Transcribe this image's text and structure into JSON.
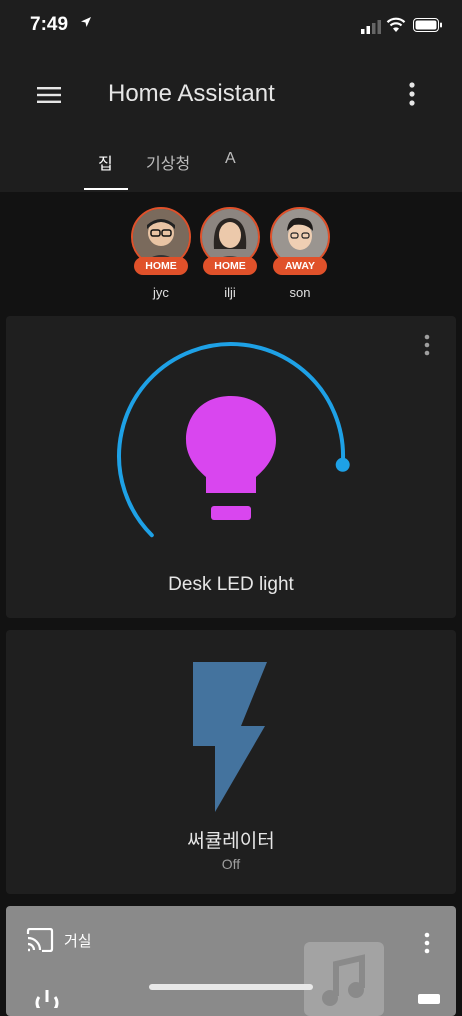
{
  "status_bar": {
    "time": "7:49"
  },
  "app_bar": {
    "title": "Home Assistant"
  },
  "tabs": [
    {
      "label": "집"
    },
    {
      "label": "기상청"
    },
    {
      "label": "A"
    }
  ],
  "badges": [
    {
      "name": "jyc",
      "state": "HOME"
    },
    {
      "name": "ilji",
      "state": "HOME"
    },
    {
      "name": "son",
      "state": "AWAY"
    }
  ],
  "light_card": {
    "name": "Desk LED light",
    "icon": "lightbulb-icon",
    "brightness_fraction": 0.85,
    "color": "#d946ef"
  },
  "switch_card": {
    "name": "써큘레이터",
    "state": "Off",
    "icon": "flash-icon"
  },
  "media_card": {
    "name": "거실",
    "icon": "cast-icon"
  },
  "colors": {
    "accent": "#e0512a",
    "slider": "#1ea1e6"
  }
}
